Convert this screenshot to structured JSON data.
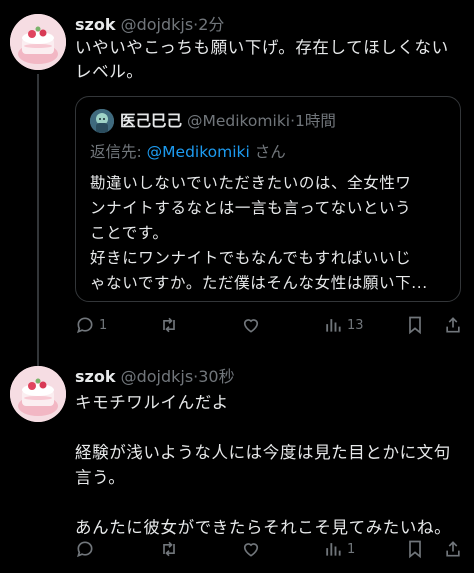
{
  "tweets": [
    {
      "name": "szok",
      "handle": "@dojdkjs",
      "dot": "·",
      "time": "2分",
      "text": "いやいやこっちも願い下げ。存在してほしくない\nレベル。",
      "quote": {
        "name": "医己巳己",
        "handle": "@Medikomiki",
        "dot": "·",
        "time": "1時間",
        "reply_prefix": "返信先: ",
        "reply_mention": "@Medikomiki",
        "reply_suffix": "さん",
        "text": "勘違いしないでいただきたいのは、全女性ワ\nンナイトするなとは一言も言ってないという\nことです。\n好きにワンナイトでもなんでもすればいいじ\nゃないですか。ただ僕はそんな女性は願い下..."
      },
      "actions": {
        "reply_count": "1",
        "retweet_count": "",
        "like_count": "",
        "views_count": "13"
      }
    },
    {
      "name": "szok",
      "handle": "@dojdkjs",
      "dot": "·",
      "time": "30秒",
      "text": "キモチワルイんだよ\n\n経験が浅いような人には今度は見た目とかに文句\n言う。\n\nあんたに彼女ができたらそれこそ見てみたいね。",
      "actions": {
        "reply_count": "",
        "retweet_count": "",
        "like_count": "",
        "views_count": "1"
      }
    }
  ],
  "icons": {
    "reply": "reply-icon",
    "retweet": "retweet-icon",
    "like": "heart-icon",
    "views": "views-icon",
    "bookmark": "bookmark-icon",
    "share": "share-icon"
  },
  "colors": {
    "background": "#000000",
    "text": "#e7e9ea",
    "secondary": "#71767b",
    "link": "#1d9bf0",
    "border": "#333639"
  }
}
